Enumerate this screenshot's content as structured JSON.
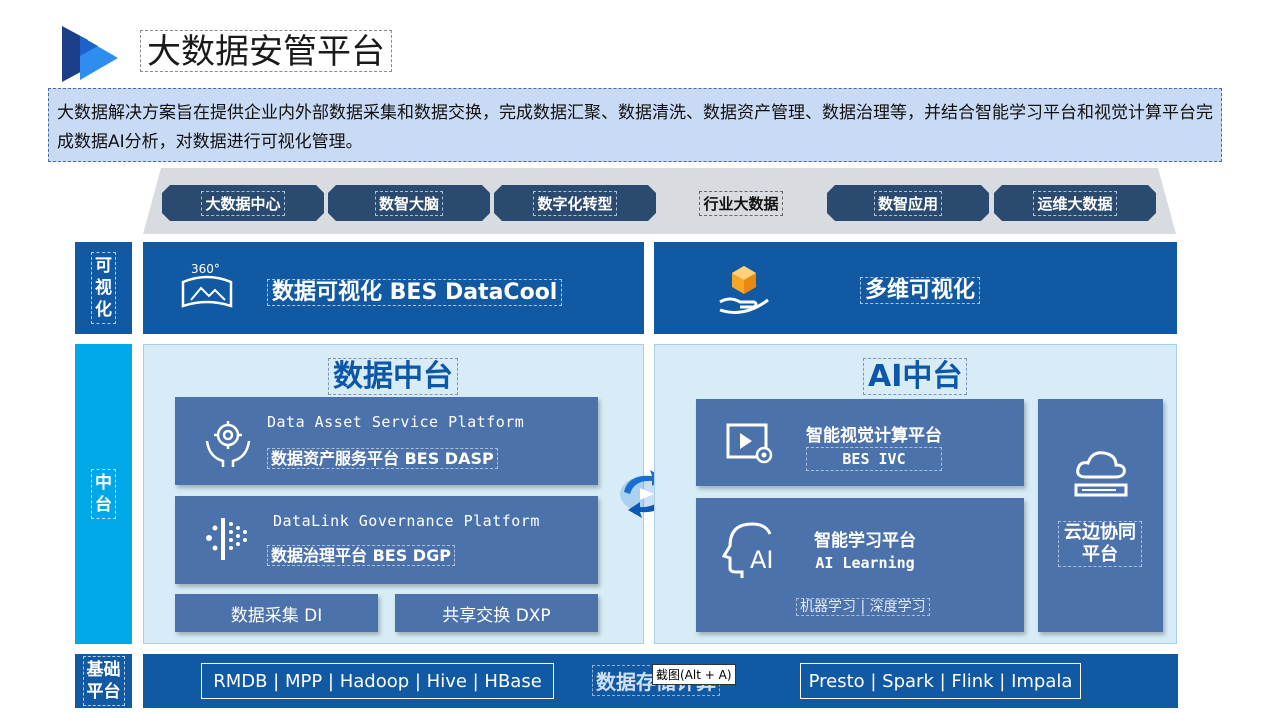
{
  "header": {
    "title": "大数据安管平台"
  },
  "description": "大数据解决方案旨在提供企业内外部数据采集和数据交换，完成数据汇聚、数据清洗、数据资产管理、数据治理等，并结合智能学习平台和视觉计算平台完成数据AI分析，对数据进行可视化管理。",
  "categories": [
    "大数据中心",
    "数智大脑",
    "数字化转型",
    "行业大数据",
    "数智应用",
    "运维大数据"
  ],
  "side_labels": {
    "visual": "可\n视\n化",
    "middle": "中\n台",
    "base": "基础\n平台"
  },
  "visual_row": {
    "left_badge": "360°",
    "left_title": "数据可视化 BES DataCool",
    "right_title": "多维可视化"
  },
  "data_platform": {
    "title": "数据中台",
    "dasp_en": "Data Asset Service Platform",
    "dasp_zh": "数据资产服务平台 BES DASP",
    "dgp_en": "DataLink Governance Platform",
    "dgp_zh": "数据治理平台 BES DGP",
    "di": "数据采集 DI",
    "dxp": "共享交换 DXP"
  },
  "ai_platform": {
    "title": "AI中台",
    "ivc_zh": "智能视觉计算平台",
    "ivc_en": "BES IVC",
    "learning_zh": "智能学习平台",
    "learning_en": "AI Learning",
    "learning_sub": "机器学习 | 深度学习",
    "cloud": "云边协同\n平台"
  },
  "base_row": {
    "left": "RMDB | MPP | Hadoop | Hive | HBase",
    "center": "数据存储计算",
    "tooltip": "截图(Alt + A)",
    "right": "Presto | Spark | Flink | Impala"
  },
  "colors": {
    "primary_blue": "#1159a3",
    "card_blue": "#4c72ab",
    "side_cyan": "#00a8e8",
    "light_panel": "#d7ecf7",
    "banner": "#c9daf5"
  }
}
